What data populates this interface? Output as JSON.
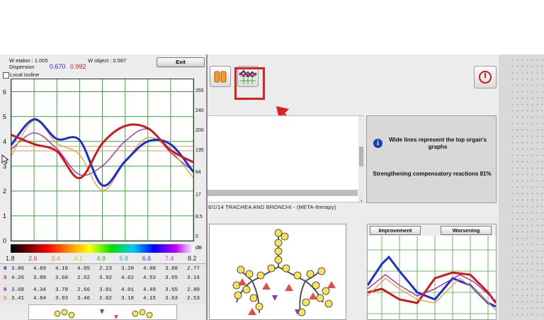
{
  "main_window": {
    "info_text_1": "Wide lines represent the top organ's graphs",
    "info_text_2": "Strengthening compensatory reactions 81%",
    "caption": "6/1/14  TRACHEA  AND  BRONCHI - (META-therapy)",
    "improvement_label": "Improvement",
    "worsening_label": "Worsening",
    "highlight_color": "#e0201e"
  },
  "left_window": {
    "w_etalon": "W etalon : 1.005",
    "w_object": "W object : 0.567",
    "dispersion_label": "Dispersion",
    "dispersion_blue": "0.670",
    "dispersion_red": "0.992",
    "exit_label": "Exit",
    "local_isoline_label": "Local isoline",
    "y_left_ticks": [
      "6",
      "5",
      "4",
      "3",
      "2",
      "1",
      "0"
    ],
    "y_right_ticks": [
      "255",
      "240",
      "200",
      "135",
      "64",
      "17",
      "8.5",
      "0"
    ],
    "db_label": "dB",
    "spectrum_values": [
      {
        "text": "1.8",
        "color": "#222222"
      },
      {
        "text": "2.6",
        "color": "#d23a3a"
      },
      {
        "text": "3.4",
        "color": "#e0862a"
      },
      {
        "text": "4.1",
        "color": "#d8c92c"
      },
      {
        "text": "4.9",
        "color": "#3aa83a"
      },
      {
        "text": "5.8",
        "color": "#2aa8c8"
      },
      {
        "text": "6.6",
        "color": "#2c49c8"
      },
      {
        "text": "7.4",
        "color": "#c43ac4"
      },
      {
        "text": "8.2",
        "color": "#222222"
      }
    ],
    "table_rows": [
      {
        "label": "N",
        "label_color": "#1a2fd0",
        "values": [
          "3.86",
          "4.89",
          "4.10",
          "4.05",
          "2.23",
          "3.20",
          "4.00",
          "3.88",
          "2.77"
        ]
      },
      {
        "label": "S",
        "label_color": "#d01a1a",
        "values": [
          "4.26",
          "3.89",
          "3.60",
          "2.52",
          "3.92",
          "4.62",
          "4.53",
          "3.65",
          "3.16"
        ]
      },
      {
        "label": "N",
        "label_color": "#b01ab0",
        "values": [
          "3.68",
          "4.34",
          "3.70",
          "2.66",
          "3.01",
          "4.01",
          "4.49",
          "3.55",
          "2.80"
        ]
      },
      {
        "label": "S",
        "label_color": "#d89020",
        "values": [
          "3.41",
          "4.84",
          "3.93",
          "3.46",
          "2.02",
          "3.18",
          "4.15",
          "3.63",
          "2.53"
        ]
      }
    ]
  },
  "chart_data": {
    "type": "line",
    "x": [
      0,
      1,
      2,
      3,
      4,
      5,
      6,
      7,
      8
    ],
    "ylim": [
      0,
      6.5
    ],
    "grid": true,
    "series": [
      {
        "color": "#1a2fd0",
        "width": 3,
        "values": [
          3.86,
          4.89,
          4.1,
          4.05,
          2.23,
          3.2,
          4.0,
          3.88,
          2.77
        ]
      },
      {
        "color": "#d01a1a",
        "width": 3,
        "values": [
          4.26,
          3.89,
          3.6,
          2.52,
          3.92,
          4.62,
          4.53,
          3.65,
          3.16
        ]
      },
      {
        "color": "#b01ab0",
        "width": 1.3,
        "values": [
          3.68,
          4.34,
          3.7,
          2.66,
          3.01,
          4.01,
          4.49,
          3.55,
          2.8
        ]
      },
      {
        "color": "#e0a040",
        "width": 1.3,
        "values": [
          3.41,
          4.84,
          3.93,
          3.46,
          2.02,
          3.18,
          4.15,
          3.63,
          2.53
        ]
      }
    ]
  }
}
